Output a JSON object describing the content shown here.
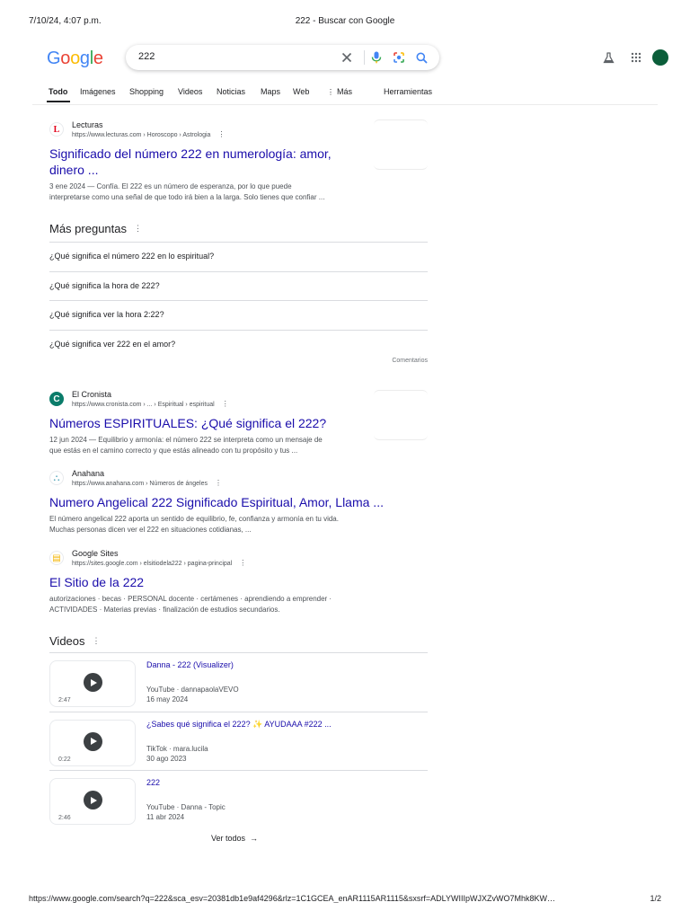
{
  "print": {
    "datetime": "7/10/24, 4:07 p.m.",
    "title": "222 - Buscar con Google",
    "footer_url": "https://www.google.com/search?q=222&sca_esv=20381db1e9af4296&rlz=1C1GCEA_enAR1115AR1115&sxsrf=ADLYWIIIpWJXZvWO7Mhk8KW…",
    "page_number": "1/2"
  },
  "logo": {
    "letters": [
      "G",
      "o",
      "o",
      "g",
      "l",
      "e"
    ],
    "colors": [
      "#4285F4",
      "#EA4335",
      "#FBBC05",
      "#4285F4",
      "#34A853",
      "#EA4335"
    ]
  },
  "search": {
    "query": "222"
  },
  "icons": {
    "clear": "close-icon",
    "voice": "microphone-icon",
    "lens": "google-lens-icon",
    "search": "search-icon",
    "labs": "flask-icon",
    "apps": "apps-grid-icon"
  },
  "tabs": [
    {
      "label": "Todo",
      "active": true
    },
    {
      "label": "Imágenes"
    },
    {
      "label": "Shopping"
    },
    {
      "label": "Videos"
    },
    {
      "label": "Noticias"
    },
    {
      "label": "Maps"
    },
    {
      "label": "Web"
    },
    {
      "label": "Más"
    },
    {
      "label": "Herramientas"
    }
  ],
  "results": [
    {
      "site": "Lecturas",
      "url": "https://www.lecturas.com › Horoscopo › Astrologia",
      "title_line1": "Significado del número 222 en numerología: amor,",
      "title_line2": "dinero ...",
      "snippet_line1": "3 ene 2024 — Confía. El 222 es un número de esperanza, por lo que puede",
      "snippet_line2": "interpretarse como una señal de que todo irá bien a la larga. Solo tienes que confiar ...",
      "favicon_text": "L"
    },
    {
      "site": "El Cronista",
      "url": "https://www.cronista.com › ... › Espiritual › espiritual",
      "title_line1": "Números ESPIRITUALES: ¿Qué significa el 222?",
      "snippet_line1": "12 jun 2024 — Equilibrio y armonía: el número 222 se interpreta como un mensaje de",
      "snippet_line2": "que estás en el camino correcto y que estás alineado con tu propósito y tus ...",
      "favicon_text": "C"
    },
    {
      "site": "Anahana",
      "url": "https://www.anahana.com › Números de ángeles",
      "title_line1": "Numero Angelical 222 Significado Espiritual, Amor, Llama ...",
      "snippet_line1": "El número angelical 222 aporta un sentido de equilibrio, fe, confianza y armonía en tu vida.",
      "snippet_line2": "Muchas personas dicen ver el 222 en situaciones cotidianas, ...",
      "favicon_text": "⛬"
    },
    {
      "site": "Google Sites",
      "url": "https://sites.google.com › elsitiodela222 › pagina-principal",
      "title_line1": "El Sitio de la 222",
      "snippet_line1": "autorizaciones · becas · PERSONAL docente · certámenes · aprendiendo a emprender ·",
      "snippet_line2": "ACTIVIDADES · Materias previas · finalización de estudios secundarios.",
      "favicon_text": "▤"
    }
  ],
  "paa": {
    "title": "Más preguntas",
    "questions": [
      "¿Qué significa el número 222 en lo espiritual?",
      "¿Qué significa la hora de 222?",
      "¿Qué significa ver la hora 2:22?",
      "¿Qué significa ver 222 en el amor?"
    ],
    "feedback": "Comentarios"
  },
  "videos": {
    "title": "Videos",
    "items": [
      {
        "title": "Danna - 222 (Visualizer)",
        "duration": "2:47",
        "source": "YouTube · dannapaolaVEVO",
        "date": "16 may 2024"
      },
      {
        "title": "¿Sabes qué significa el 222? ✨ AYUDAAA #222 ...",
        "duration": "0:22",
        "source": "TikTok · mara.lucila",
        "date": "30 ago 2023"
      },
      {
        "title": "222",
        "duration": "2:46",
        "source": "YouTube · Danna - Topic",
        "date": "11 abr 2024"
      }
    ],
    "see_all": "Ver todos"
  }
}
